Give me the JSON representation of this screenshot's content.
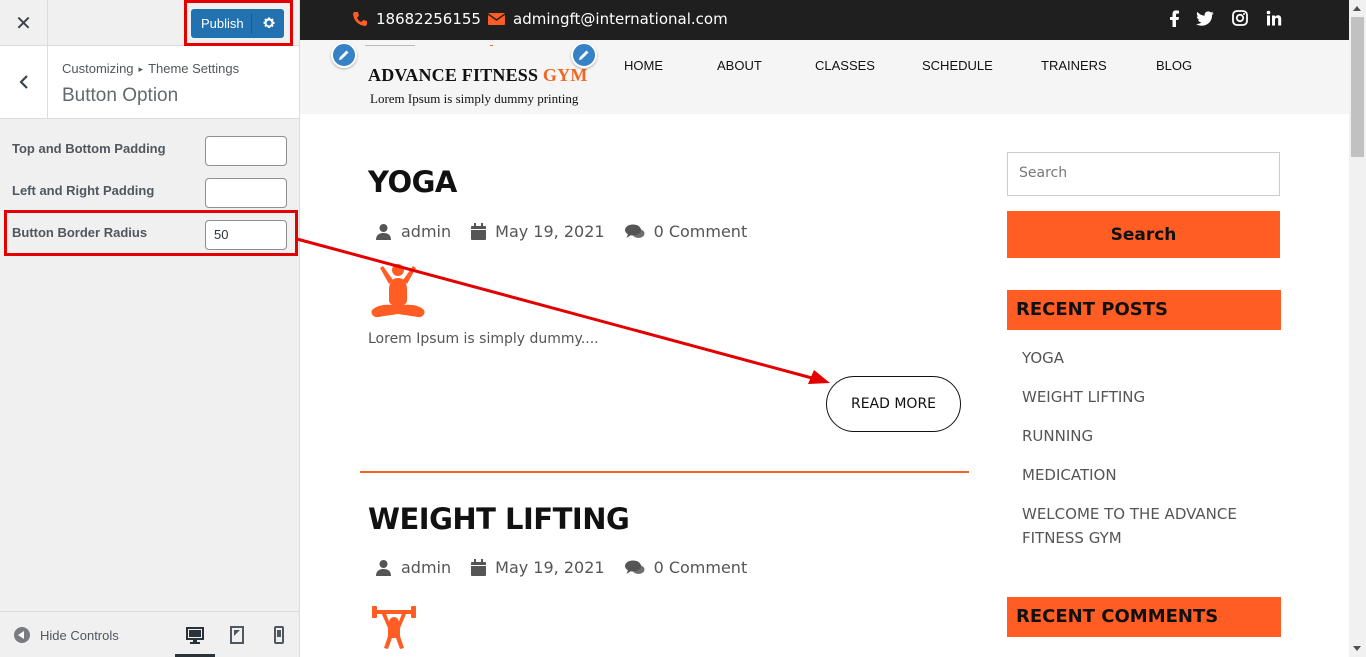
{
  "customizer": {
    "close_label": "✕",
    "publish_label": "Publish",
    "breadcrumb_root": "Customizing",
    "breadcrumb_parent": "Theme Settings",
    "section_title": "Button Option",
    "fields": [
      {
        "label": "Top and Bottom Padding",
        "value": ""
      },
      {
        "label": "Left and Right Padding",
        "value": ""
      },
      {
        "label": "Button Border Radius",
        "value": "50"
      }
    ],
    "hide_controls_label": "Hide Controls",
    "devices": [
      "desktop-icon",
      "tablet-icon",
      "mobile-icon"
    ]
  },
  "site": {
    "topbar": {
      "phone": "18682256155",
      "email": "admingft@international.com",
      "social": [
        "facebook-icon",
        "twitter-icon",
        "instagram-icon",
        "linkedin-icon"
      ]
    },
    "logo": {
      "title_main": "ADVANCE FITNESS ",
      "title_accent": "GYM",
      "tagline": "Lorem Ipsum is simply dummy printing"
    },
    "nav": [
      "HOME",
      "ABOUT",
      "CLASSES",
      "SCHEDULE",
      "TRAINERS",
      "BLOG"
    ],
    "posts": [
      {
        "title": "YOGA",
        "author": "admin",
        "date": "May 19, 2021",
        "comments": "0 Comment",
        "excerpt": "Lorem Ipsum is simply dummy....",
        "read_more": "READ MORE"
      },
      {
        "title": "WEIGHT LIFTING",
        "author": "admin",
        "date": "May 19, 2021",
        "comments": "0 Comment"
      }
    ],
    "sidebar": {
      "search_placeholder": "Search",
      "search_button": "Search",
      "recent_posts_title": "RECENT POSTS",
      "recent_posts": [
        "YOGA",
        "WEIGHT LIFTING",
        "RUNNING",
        "MEDICATION",
        "WELCOME TO THE ADVANCE FITNESS GYM"
      ],
      "recent_comments_title": "RECENT COMMENTS"
    }
  },
  "colors": {
    "accent": "#ff5d24",
    "publish": "#2271b1",
    "highlight": "#e30000"
  }
}
